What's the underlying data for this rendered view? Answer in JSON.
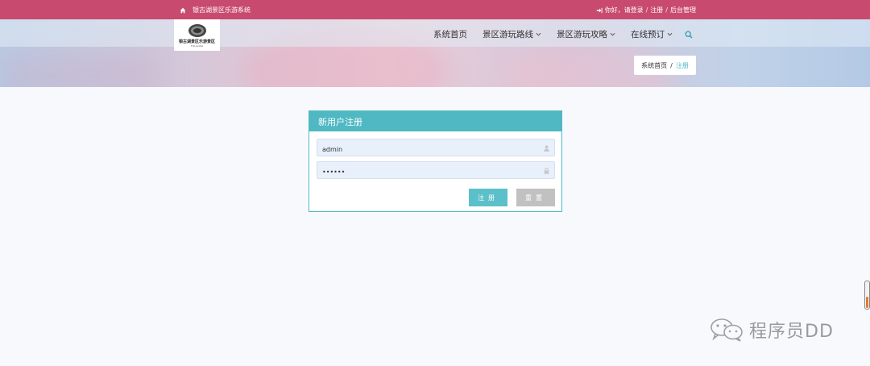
{
  "topbar": {
    "site_name": "银古湖景区乐游系统",
    "greeting": "你好，请登录",
    "sep": "/",
    "register_link": "注册",
    "admin_link": "后台管理"
  },
  "logo": {
    "text": "银古湖景区乐游景区",
    "sub": "Trip.Antke"
  },
  "nav": {
    "items": [
      {
        "label": "系统首页"
      },
      {
        "label": "景区游玩路线"
      },
      {
        "label": "景区游玩攻略"
      },
      {
        "label": "在线预订"
      }
    ]
  },
  "breadcrumb": {
    "home": "系统首页",
    "sep": "/",
    "current": "注册"
  },
  "register": {
    "title": "新用户注册",
    "username_value": "admin",
    "password_value": "••••••",
    "register_button": "注册",
    "reset_button": "重置"
  },
  "watermark": {
    "text": "程序员DD"
  },
  "colors": {
    "topbar": "#c84a6f",
    "accent": "#4fb8c3",
    "reset": "#c1c1c1"
  }
}
